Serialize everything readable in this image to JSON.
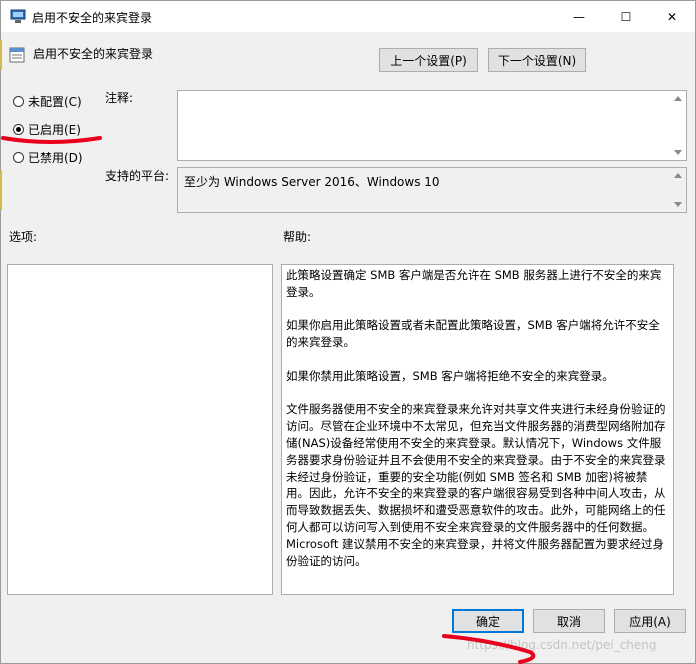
{
  "window": {
    "title": "启用不安全的来宾登录",
    "controls": {
      "minimize": "—",
      "maximize": "☐",
      "close": "✕"
    }
  },
  "header": {
    "title": "启用不安全的来宾登录",
    "prev_button": "上一个设置(P)",
    "next_button": "下一个设置(N)"
  },
  "state": {
    "options": [
      {
        "label": "未配置(C)",
        "selected": false
      },
      {
        "label": "已启用(E)",
        "selected": true
      },
      {
        "label": "已禁用(D)",
        "selected": false
      }
    ]
  },
  "comment": {
    "label": "注释:",
    "value": ""
  },
  "platform": {
    "label": "支持的平台:",
    "value": "至少为 Windows Server 2016、Windows 10"
  },
  "options_panel": {
    "label": "选项:"
  },
  "help_panel": {
    "label": "帮助:",
    "paragraphs": [
      "此策略设置确定 SMB 客户端是否允许在 SMB 服务器上进行不安全的来宾登录。",
      "如果你启用此策略设置或者未配置此策略设置，SMB 客户端将允许不安全的来宾登录。",
      "如果你禁用此策略设置，SMB 客户端将拒绝不安全的来宾登录。",
      "文件服务器使用不安全的来宾登录来允许对共享文件夹进行未经身份验证的访问。尽管在企业环境中不太常见，但充当文件服务器的消费型网络附加存储(NAS)设备经常使用不安全的来宾登录。默认情况下，Windows 文件服务器要求身份验证并且不会使用不安全的来宾登录。由于不安全的来宾登录未经过身份验证，重要的安全功能(例如 SMB 签名和 SMB 加密)将被禁用。因此，允许不安全的来宾登录的客户端很容易受到各种中间人攻击，从而导致数据丢失、数据损坏和遭受恶意软件的攻击。此外，可能网络上的任何人都可以访问写入到使用不安全来宾登录的文件服务器中的任何数据。Microsoft 建议禁用不安全的来宾登录，并将文件服务器配置为要求经过身份验证的访问。"
    ]
  },
  "footer": {
    "ok": "确定",
    "cancel": "取消",
    "apply": "应用(A)"
  },
  "watermark": "https://blog.csdn.net/pei_cheng",
  "colors": {
    "annotation": "#e8001c",
    "focus": "#0078d7"
  }
}
